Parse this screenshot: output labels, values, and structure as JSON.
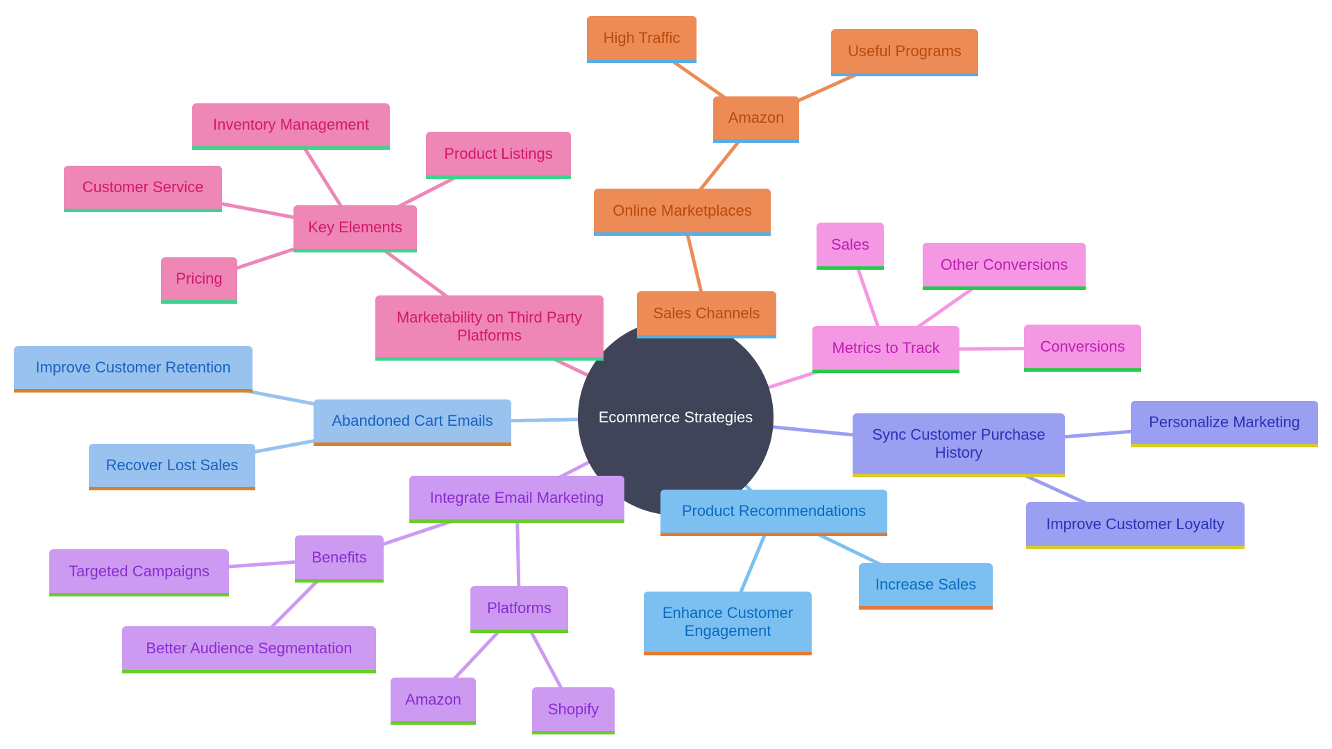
{
  "title": "Ecommerce Strategies",
  "root": {
    "id": "root",
    "label": "Ecommerce Strategies",
    "fill": "#404459",
    "text": "#ffffff"
  },
  "branches": [
    {
      "name": "sales-channels",
      "colors": {
        "fill": "#EC8B56",
        "text": "#B84A0C",
        "border": "#5AADE3",
        "edge": "#EC8B56"
      },
      "nodes": [
        {
          "id": "sales-channels",
          "label": "Sales Channels",
          "parent": "root"
        },
        {
          "id": "online-marketplaces",
          "label": "Online Marketplaces",
          "parent": "sales-channels"
        },
        {
          "id": "amazon-market",
          "label": "Amazon",
          "parent": "online-marketplaces"
        },
        {
          "id": "high-traffic",
          "label": "High Traffic",
          "parent": "amazon-market"
        },
        {
          "id": "useful-programs",
          "label": "Useful Programs",
          "parent": "amazon-market"
        }
      ]
    },
    {
      "name": "marketability",
      "colors": {
        "fill": "#EE86B6",
        "text": "#D2186C",
        "border": "#3AD68C",
        "edge": "#EE86B6"
      },
      "nodes": [
        {
          "id": "marketability",
          "label": "Marketability on Third Party Platforms",
          "parent": "root"
        },
        {
          "id": "key-elements",
          "label": "Key Elements",
          "parent": "marketability"
        },
        {
          "id": "inventory-management",
          "label": "Inventory Management",
          "parent": "key-elements"
        },
        {
          "id": "product-listings",
          "label": "Product Listings",
          "parent": "key-elements"
        },
        {
          "id": "customer-service",
          "label": "Customer Service",
          "parent": "key-elements"
        },
        {
          "id": "pricing",
          "label": "Pricing",
          "parent": "key-elements"
        }
      ]
    },
    {
      "name": "metrics",
      "colors": {
        "fill": "#F498E4",
        "text": "#BE1EB2",
        "border": "#24CC46",
        "edge": "#F498E4"
      },
      "nodes": [
        {
          "id": "metrics-to-track",
          "label": "Metrics to Track",
          "parent": "root"
        },
        {
          "id": "sales",
          "label": "Sales",
          "parent": "metrics-to-track"
        },
        {
          "id": "other-conversions",
          "label": "Other Conversions",
          "parent": "metrics-to-track"
        },
        {
          "id": "conversions",
          "label": "Conversions",
          "parent": "metrics-to-track"
        }
      ]
    },
    {
      "name": "sync-history",
      "colors": {
        "fill": "#9A9FF1",
        "text": "#2B32B6",
        "border": "#D8CC2C",
        "edge": "#9A9FF1"
      },
      "nodes": [
        {
          "id": "sync-purchase-history",
          "label": "Sync Customer Purchase History",
          "parent": "root"
        },
        {
          "id": "personalize-marketing",
          "label": "Personalize Marketing",
          "parent": "sync-purchase-history"
        },
        {
          "id": "improve-loyalty",
          "label": "Improve Customer Loyalty",
          "parent": "sync-purchase-history"
        }
      ]
    },
    {
      "name": "product-recommendations",
      "colors": {
        "fill": "#7BC0F1",
        "text": "#0C6AC0",
        "border": "#E27B34",
        "edge": "#7BC0F1"
      },
      "nodes": [
        {
          "id": "product-recommendations",
          "label": "Product Recommendations",
          "parent": "root"
        },
        {
          "id": "increase-sales",
          "label": "Increase Sales",
          "parent": "product-recommendations"
        },
        {
          "id": "enhance-engagement",
          "label": "Enhance Customer Engagement",
          "parent": "product-recommendations"
        }
      ]
    },
    {
      "name": "abandoned-cart",
      "colors": {
        "fill": "#9AC2EF",
        "text": "#1862C0",
        "border": "#D6822E",
        "edge": "#9AC2EF"
      },
      "nodes": [
        {
          "id": "abandoned-cart-emails",
          "label": "Abandoned Cart Emails",
          "parent": "root"
        },
        {
          "id": "improve-retention",
          "label": "Improve Customer Retention",
          "parent": "abandoned-cart-emails"
        },
        {
          "id": "recover-lost-sales",
          "label": "Recover Lost Sales",
          "parent": "abandoned-cart-emails"
        }
      ]
    },
    {
      "name": "email-marketing",
      "colors": {
        "fill": "#CD9AF2",
        "text": "#8A2CD0",
        "border": "#68CC2A",
        "edge": "#CD9AF2"
      },
      "nodes": [
        {
          "id": "integrate-email-marketing",
          "label": "Integrate Email Marketing",
          "parent": "root"
        },
        {
          "id": "benefits",
          "label": "Benefits",
          "parent": "integrate-email-marketing"
        },
        {
          "id": "targeted-campaigns",
          "label": "Targeted Campaigns",
          "parent": "benefits"
        },
        {
          "id": "audience-segmentation",
          "label": "Better Audience Segmentation",
          "parent": "benefits"
        },
        {
          "id": "platforms",
          "label": "Platforms",
          "parent": "integrate-email-marketing"
        },
        {
          "id": "amazon-platform",
          "label": "Amazon",
          "parent": "platforms"
        },
        {
          "id": "shopify",
          "label": "Shopify",
          "parent": "platforms"
        }
      ]
    }
  ]
}
